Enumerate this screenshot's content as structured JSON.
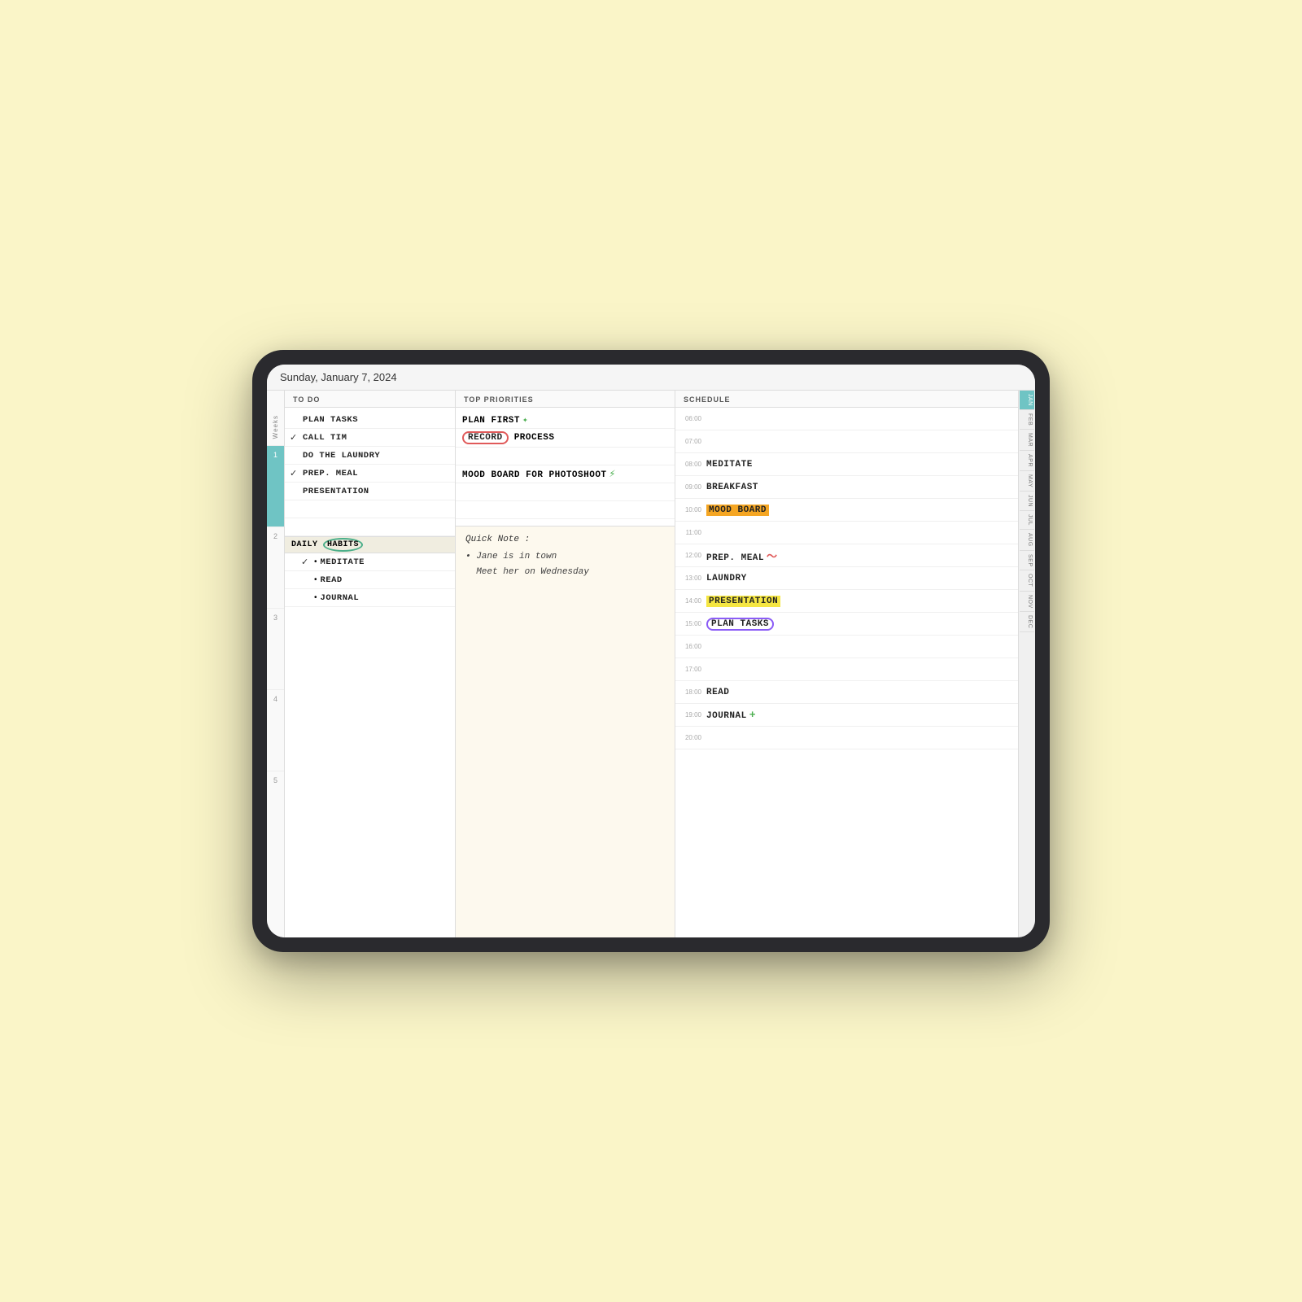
{
  "header": {
    "date": "Sunday, January 7, 2024"
  },
  "sidebar": {
    "label": "Weeks",
    "week_numbers": [
      "1",
      "2",
      "3",
      "4",
      "5"
    ]
  },
  "todo": {
    "column_header": "TO DO",
    "items": [
      {
        "id": 1,
        "checked": false,
        "text": "PLAN TASKS"
      },
      {
        "id": 2,
        "checked": true,
        "text": "CALL TIM"
      },
      {
        "id": 3,
        "checked": false,
        "text": "DO THE LAUNDRY"
      },
      {
        "id": 4,
        "checked": true,
        "text": "PREP. MEAL"
      },
      {
        "id": 5,
        "checked": false,
        "text": "PRESENTATION"
      }
    ],
    "daily_habits_label": "DAILY",
    "habits_circle_label": "HABITS",
    "habits": [
      {
        "id": 1,
        "checked": true,
        "text": "MEDITATE"
      },
      {
        "id": 2,
        "checked": false,
        "text": "READ"
      },
      {
        "id": 3,
        "checked": false,
        "text": "JOURNAL"
      }
    ]
  },
  "priorities": {
    "column_header": "TOP PRIORITIES",
    "items": [
      {
        "id": 1,
        "text": "PLAN FIRST",
        "has_star": true
      },
      {
        "id": 2,
        "text_before": "",
        "circled": "RECORD",
        "text_after": " PROCESS"
      },
      {
        "id": 3,
        "text": ""
      },
      {
        "id": 4,
        "text": "MOOD BOARD FOR PHOTOSHOOT",
        "has_lightning": true
      }
    ],
    "note_title": "Quick Note :",
    "note_items": [
      "• Jane is in town",
      "  Meet her on Wednesday"
    ]
  },
  "schedule": {
    "column_header": "SCHEDULE",
    "rows": [
      {
        "time": "06:00",
        "text": ""
      },
      {
        "time": "07:00",
        "text": ""
      },
      {
        "time": "08:00",
        "text": "MEDITATE"
      },
      {
        "time": "09:00",
        "text": "BREAKFAST"
      },
      {
        "time": "10:00",
        "text": "MOOD BOARD",
        "style": "orange"
      },
      {
        "time": "11:00",
        "text": ""
      },
      {
        "time": "12:00",
        "text": "PREP. MEAL",
        "style": "wavy"
      },
      {
        "time": "13:00",
        "text": "LAUNDRY"
      },
      {
        "time": "14:00",
        "text": "PRESENTATION",
        "style": "yellow-highlight"
      },
      {
        "time": "15:00",
        "text": "PLAN TASKS",
        "style": "circle-purple"
      },
      {
        "time": "16:00",
        "text": ""
      },
      {
        "time": "17:00",
        "text": ""
      },
      {
        "time": "18:00",
        "text": "READ"
      },
      {
        "time": "19:00",
        "text": "JOURNAL",
        "style": "plus"
      },
      {
        "time": "20:00",
        "text": ""
      }
    ]
  },
  "month_tabs": {
    "active": "JAN",
    "months": [
      "JAN",
      "FEB",
      "MAR",
      "APR",
      "MAY",
      "JUN",
      "JUL",
      "AUG",
      "SEP",
      "OCT",
      "NOV",
      "DEC"
    ]
  }
}
